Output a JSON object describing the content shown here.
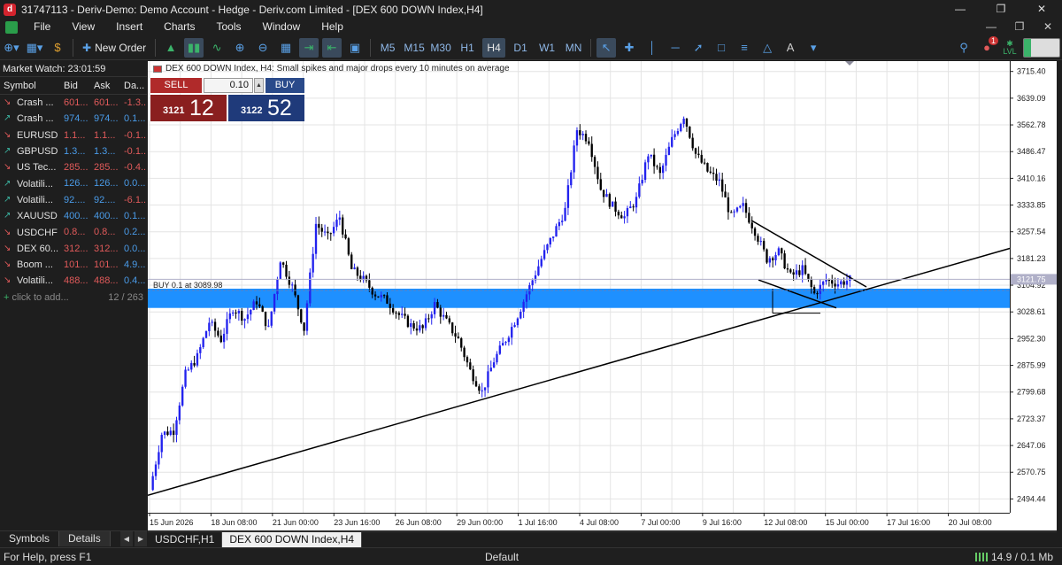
{
  "window": {
    "title": "31747113 - Deriv-Demo: Demo Account - Hedge - Deriv.com Limited - [DEX 600 DOWN Index,H4]",
    "minimize_icon": "minimize-icon",
    "restore_icon": "restore-icon",
    "close_icon": "close-icon"
  },
  "menu": {
    "items": [
      "File",
      "View",
      "Insert",
      "Charts",
      "Tools",
      "Window",
      "Help"
    ]
  },
  "toolbar": {
    "new_order_label": "New Order",
    "timeframes": [
      "M5",
      "M15",
      "M30",
      "H1",
      "H4",
      "D1",
      "W1",
      "MN"
    ],
    "active_timeframe": "H4",
    "notification_count": "1",
    "lvl_label": "LVL"
  },
  "market_watch": {
    "title": "Market Watch: 23:01:59",
    "headers": {
      "symbol": "Symbol",
      "bid": "Bid",
      "ask": "Ask",
      "daily": "Da..."
    },
    "rows": [
      {
        "symbol": "Crash ...",
        "bid": "601...",
        "ask": "601...",
        "daily": "-1.3...",
        "dir": "down"
      },
      {
        "symbol": "Crash ...",
        "bid": "974...",
        "ask": "974...",
        "daily": "0.1...",
        "dir": "up"
      },
      {
        "symbol": "EURUSD",
        "bid": "1.1...",
        "ask": "1.1...",
        "daily": "-0.1...",
        "dir": "down"
      },
      {
        "symbol": "GBPUSD",
        "bid": "1.3...",
        "ask": "1.3...",
        "daily": "-0.1...",
        "dir": "up"
      },
      {
        "symbol": "US Tec...",
        "bid": "285...",
        "ask": "285...",
        "daily": "-0.4...",
        "dir": "down"
      },
      {
        "symbol": "Volatili...",
        "bid": "126...",
        "ask": "126...",
        "daily": "0.0...",
        "dir": "up"
      },
      {
        "symbol": "Volatili...",
        "bid": "92....",
        "ask": "92....",
        "daily": "-6.1...",
        "dir": "up"
      },
      {
        "symbol": "XAUUSD",
        "bid": "400...",
        "ask": "400...",
        "daily": "0.1...",
        "dir": "up"
      },
      {
        "symbol": "USDCHF",
        "bid": "0.8...",
        "ask": "0.8...",
        "daily": "0.2...",
        "dir": "down"
      },
      {
        "symbol": "DEX 60...",
        "bid": "312...",
        "ask": "312...",
        "daily": "0.0...",
        "dir": "down"
      },
      {
        "symbol": "Boom ...",
        "bid": "101...",
        "ask": "101...",
        "daily": "4.9...",
        "dir": "down"
      },
      {
        "symbol": "Volatili...",
        "bid": "488...",
        "ask": "488...",
        "daily": "0.4...",
        "dir": "down"
      }
    ],
    "add_label": "click to add...",
    "count": "12 / 263"
  },
  "bottom_tabs": {
    "symbols": "Symbols",
    "details": "Details"
  },
  "chart_tabs": [
    "USDCHF,H1",
    "DEX 600 DOWN Index,H4"
  ],
  "status": {
    "help": "For Help, press F1",
    "profile": "Default",
    "traffic": "14.9 / 0.1 Mb"
  },
  "one_click": {
    "sell_label": "SELL",
    "buy_label": "BUY",
    "lot": "0.10",
    "bid_small": "3121",
    "bid_big": "12",
    "ask_small": "3122",
    "ask_big": "52"
  },
  "chart_data": {
    "type": "candlestick",
    "title": "DEX 600 DOWN Index, H4:  Small spikes and major drops every 10 minutes on average",
    "ylim": [
      2455,
      3745
    ],
    "y_ticks": [
      "3715.40",
      "3639.09",
      "3562.78",
      "3486.47",
      "3410.16",
      "3333.85",
      "3257.54",
      "3181.23",
      "3104.92",
      "3028.61",
      "2952.30",
      "2875.99",
      "2799.68",
      "2723.37",
      "2647.06",
      "2570.75",
      "2494.44"
    ],
    "y_tick_values": [
      3715.4,
      3639.09,
      3562.78,
      3486.47,
      3410.16,
      3333.85,
      3257.54,
      3181.23,
      3104.92,
      3028.61,
      2952.3,
      2875.99,
      2799.68,
      2723.37,
      2647.06,
      2570.75,
      2494.44
    ],
    "x_ticks": [
      "15 Jun 2026",
      "18 Jun 08:00",
      "21 Jun 00:00",
      "23 Jun 16:00",
      "26 Jun 08:00",
      "29 Jun 00:00",
      "1 Jul 16:00",
      "4 Jul 08:00",
      "7 Jul 00:00",
      "9 Jul 16:00",
      "12 Jul 08:00",
      "15 Jul 00:00",
      "17 Jul 16:00",
      "20 Jul 08:00"
    ],
    "current_price_label": "3121.75",
    "current_price": 3121.75,
    "buy_line_label": "BUY 0.1 at 3089.98",
    "buy_line_price": 3089.98,
    "zone": [
      3040,
      3095
    ],
    "colors": {
      "bull": "#2222ee",
      "bear": "#000000",
      "zone": "#1e90ff",
      "price_line": "#b0b0c8"
    },
    "path": [
      2520,
      2680,
      2690,
      2850,
      2900,
      3000,
      2950,
      3040,
      3010,
      3060,
      2980,
      3180,
      3100,
      2980,
      3280,
      3240,
      3300,
      3150,
      3120,
      3080,
      3060,
      3020,
      2990,
      2980,
      3050,
      3000,
      2950,
      2860,
      2800,
      2890,
      2950,
      3020,
      3100,
      3180,
      3250,
      3320,
      3550,
      3520,
      3380,
      3330,
      3300,
      3350,
      3480,
      3420,
      3520,
      3590,
      3480,
      3430,
      3400,
      3300,
      3330,
      3260,
      3180,
      3200,
      3130,
      3150,
      3080,
      3120,
      3110,
      3121
    ]
  }
}
